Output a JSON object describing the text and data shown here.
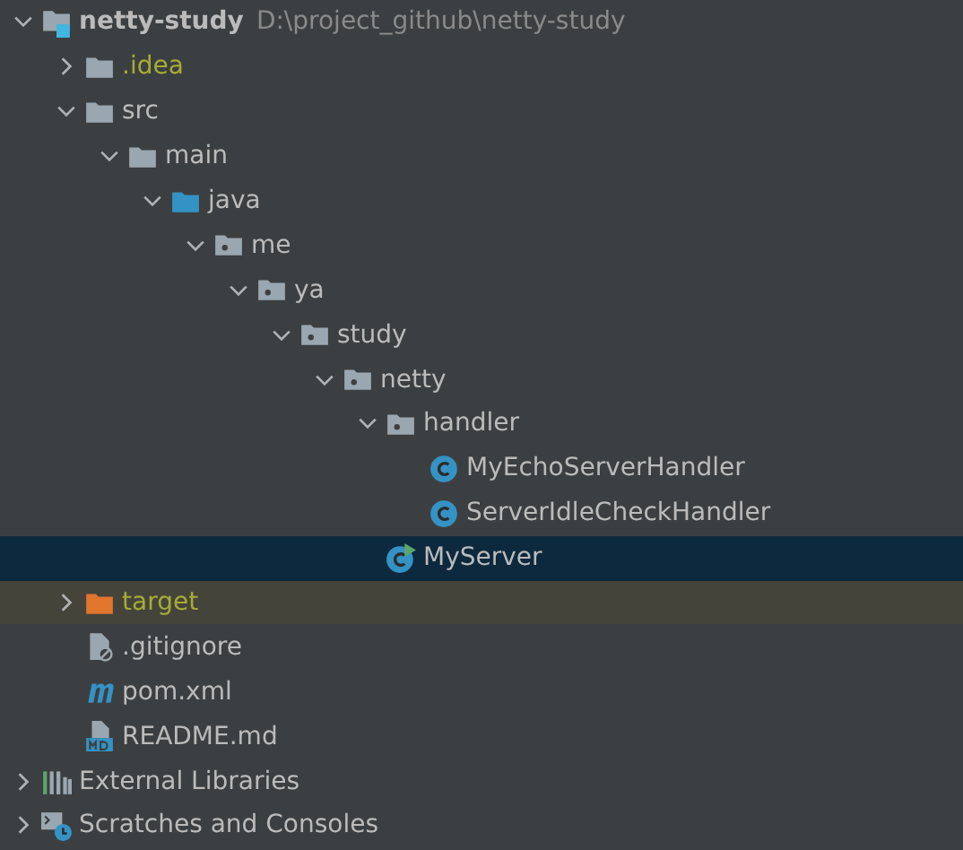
{
  "project_tree": [
    {
      "label": "netty-study",
      "detail": "D:\\project_github\\netty-study",
      "kind": "module",
      "expanded": true,
      "selected": false,
      "children": [
        {
          "label": ".idea",
          "kind": "folder",
          "expanded": false,
          "selected": false,
          "ignored": true
        },
        {
          "label": "src",
          "kind": "folder",
          "expanded": true,
          "selected": false,
          "children": [
            {
              "label": "main",
              "kind": "folder",
              "expanded": true,
              "selected": false,
              "children": [
                {
                  "label": "java",
                  "kind": "source",
                  "expanded": true,
                  "selected": false,
                  "children": [
                    {
                      "label": "me",
                      "kind": "package",
                      "expanded": true,
                      "selected": false,
                      "children": [
                        {
                          "label": "ya",
                          "kind": "package",
                          "expanded": true,
                          "selected": false,
                          "children": [
                            {
                              "label": "study",
                              "kind": "package",
                              "expanded": true,
                              "selected": false,
                              "children": [
                                {
                                  "label": "netty",
                                  "kind": "package",
                                  "expanded": true,
                                  "selected": false,
                                  "children": [
                                    {
                                      "label": "handler",
                                      "kind": "package",
                                      "expanded": true,
                                      "selected": false,
                                      "children": [
                                        {
                                          "label": "MyEchoServerHandler",
                                          "kind": "class",
                                          "selected": false
                                        },
                                        {
                                          "label": "ServerIdleCheckHandler",
                                          "kind": "class",
                                          "selected": false
                                        }
                                      ]
                                    },
                                    {
                                      "label": "MyServer",
                                      "kind": "runnable",
                                      "selected": true
                                    }
                                  ]
                                }
                              ]
                            }
                          ]
                        }
                      ]
                    }
                  ]
                }
              ]
            }
          ]
        },
        {
          "label": "target",
          "kind": "excluded",
          "expanded": false,
          "selected": false,
          "ignored": true,
          "excluded": true
        },
        {
          "label": ".gitignore",
          "kind": "ignorefile",
          "selected": false
        },
        {
          "label": "pom.xml",
          "kind": "maven",
          "selected": false
        },
        {
          "label": "README.md",
          "kind": "markdown",
          "selected": false
        }
      ]
    },
    {
      "label": "External Libraries",
      "kind": "libraries",
      "expanded": false,
      "selected": false
    },
    {
      "label": "Scratches and Consoles",
      "kind": "scratches",
      "expanded": false,
      "selected": false
    }
  ]
}
